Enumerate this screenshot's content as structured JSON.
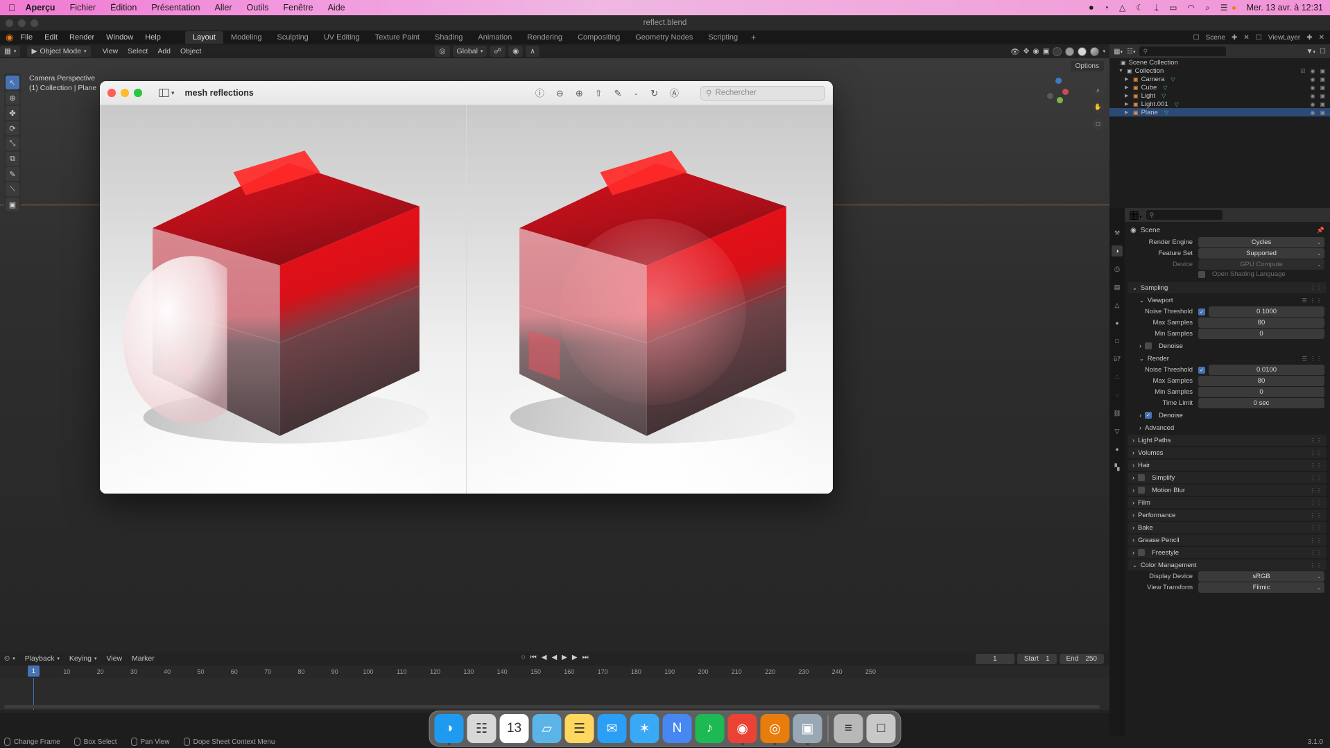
{
  "macbar": {
    "apple_icon": "apple-logo",
    "menus": [
      {
        "label": "Aperçu",
        "bold": true
      },
      {
        "label": "Fichier",
        "bold": false
      },
      {
        "label": "Édition",
        "bold": false
      },
      {
        "label": "Présentation",
        "bold": false
      },
      {
        "label": "Aller",
        "bold": false
      },
      {
        "label": "Outils",
        "bold": false
      },
      {
        "label": "Fenêtre",
        "bold": false
      },
      {
        "label": "Aide",
        "bold": false
      }
    ],
    "status_icons": [
      {
        "name": "record-icon",
        "glyph": "⏺"
      },
      {
        "name": "safari-compass-icon",
        "glyph": "◔"
      },
      {
        "name": "dropbox-icon",
        "glyph": "△"
      },
      {
        "name": "do-not-disturb-moon-icon",
        "glyph": "☾"
      },
      {
        "name": "bluetooth-icon",
        "glyph": "ᛦ"
      },
      {
        "name": "battery-charging-icon",
        "glyph": "▭"
      },
      {
        "name": "wifi-icon",
        "glyph": "◠"
      },
      {
        "name": "spotlight-search-icon",
        "glyph": "⌕"
      },
      {
        "name": "control-center-icon",
        "glyph": "☰"
      }
    ],
    "clock": "Mer. 13 avr. à  12:31",
    "accent_pink": "#f093d8"
  },
  "blender_window": {
    "filename": "reflect.blend"
  },
  "topbar": {
    "logo_icon": "blender-logo-icon",
    "menus": [
      "File",
      "Edit",
      "Render",
      "Window",
      "Help"
    ],
    "workspaces": [
      "Layout",
      "Modeling",
      "Sculpting",
      "UV Editing",
      "Texture Paint",
      "Shading",
      "Animation",
      "Rendering",
      "Compositing",
      "Geometry Nodes",
      "Scripting"
    ],
    "active_workspace": "Layout",
    "add_workspace": "+",
    "scene_label": "Scene",
    "viewlayer_label": "ViewLayer"
  },
  "viewport_header": {
    "mode": "Object Mode",
    "menus": [
      "View",
      "Select",
      "Add",
      "Object"
    ],
    "transform_orientation": "Global",
    "options_label": "Options",
    "icons": [
      "editor-type-icon",
      "mode-dropdown-icon",
      "snap-magnet-icon",
      "proportional-edit-icon",
      "overlays-icon",
      "xray-icon"
    ]
  },
  "viewport": {
    "overlay_line1": "Camera Perspective",
    "overlay_line2": "(1) Collection | Plane",
    "tools": [
      {
        "name": "tweak-select-tool",
        "glyph": "↖",
        "selected": true
      },
      {
        "name": "cursor-tool",
        "glyph": "⊕",
        "selected": false
      },
      {
        "name": "move-tool",
        "glyph": "✤",
        "selected": false
      },
      {
        "name": "rotate-tool",
        "glyph": "⟳",
        "selected": false
      },
      {
        "name": "scale-tool",
        "glyph": "⤡",
        "selected": false
      },
      {
        "name": "transform-tool",
        "glyph": "⧉",
        "selected": false
      },
      {
        "name": "annotate-tool",
        "glyph": "✎",
        "selected": false
      },
      {
        "name": "measure-tool",
        "glyph": "⟍",
        "selected": false
      },
      {
        "name": "add-cube-tool",
        "glyph": "▣",
        "selected": false
      }
    ],
    "nav_buttons": [
      {
        "name": "zoom-nav-button",
        "glyph": "⌕"
      },
      {
        "name": "pan-nav-button",
        "glyph": "✋"
      },
      {
        "name": "camera-view-button",
        "glyph": "□"
      }
    ],
    "gizmo_axes": [
      "X",
      "Y",
      "Z"
    ],
    "cursor_glyph": "+"
  },
  "preview_window": {
    "title": "mesh reflections",
    "traffic_lights": [
      "close-button",
      "minimize-button",
      "maximize-button"
    ],
    "sidebar_toggle_icon": "sidebar-toggle-icon",
    "toolbar_icons": [
      {
        "name": "info-icon",
        "glyph": "ⓘ"
      },
      {
        "name": "zoom-out-icon",
        "glyph": "⊖"
      },
      {
        "name": "zoom-in-icon",
        "glyph": "⊕"
      },
      {
        "name": "share-icon",
        "glyph": "⇧"
      },
      {
        "name": "markup-pen-icon",
        "glyph": "✎"
      },
      {
        "name": "markup-chevron-icon",
        "glyph": "⌄"
      },
      {
        "name": "rotate-icon",
        "glyph": "↻"
      },
      {
        "name": "annotate-icon",
        "glyph": "Ⓐ"
      }
    ],
    "search_placeholder": "Rechercher",
    "search_value": "",
    "image_description": "Two side-by-side renders of a translucent red glass cube on a glossy white floor with reflections"
  },
  "outliner": {
    "header_icons": [
      "editor-type-icon",
      "display-mode-icon",
      "filter-icon",
      "new-collection-icon"
    ],
    "search_placeholder": "",
    "rows": [
      {
        "label": "Scene Collection",
        "indent": 0,
        "icon": "scene-collection-icon",
        "expand": "",
        "selected": false,
        "eyes": false
      },
      {
        "label": "Collection",
        "indent": 1,
        "icon": "collection-icon",
        "expand": "▼",
        "selected": false,
        "eyes": true,
        "check": true
      },
      {
        "label": "Camera",
        "indent": 2,
        "icon": "camera-object-icon",
        "expand": "▶",
        "selected": false,
        "eyes": true,
        "data_icon": "camera-data-icon"
      },
      {
        "label": "Cube",
        "indent": 2,
        "icon": "mesh-object-icon",
        "expand": "▶",
        "selected": false,
        "eyes": true,
        "data_icon": "mesh-data-icon"
      },
      {
        "label": "Light",
        "indent": 2,
        "icon": "light-object-icon",
        "expand": "▶",
        "selected": false,
        "eyes": true,
        "data_icon": "light-data-icon"
      },
      {
        "label": "Light.001",
        "indent": 2,
        "icon": "light-object-icon",
        "expand": "▶",
        "selected": false,
        "eyes": true,
        "data_icon": "light-data-icon"
      },
      {
        "label": "Plane",
        "indent": 2,
        "icon": "mesh-object-icon",
        "expand": "▶",
        "selected": true,
        "eyes": true,
        "data_icon": "mesh-data-icon"
      }
    ]
  },
  "properties": {
    "tabs": [
      {
        "name": "tool-tab",
        "glyph": "⚒",
        "active": false
      },
      {
        "name": "render-tab",
        "glyph": "◑",
        "active": true
      },
      {
        "name": "output-tab",
        "glyph": "⎙",
        "active": false
      },
      {
        "name": "view-layer-tab",
        "glyph": "▤",
        "active": false
      },
      {
        "name": "scene-tab",
        "glyph": "△",
        "active": false
      },
      {
        "name": "world-tab",
        "glyph": "●",
        "active": false
      },
      {
        "name": "object-tab",
        "glyph": "□",
        "active": false
      },
      {
        "name": "modifier-tab",
        "glyph": "ὒ7",
        "active": false
      },
      {
        "name": "particles-tab",
        "glyph": "∴",
        "active": false
      },
      {
        "name": "physics-tab",
        "glyph": "◌",
        "active": false
      },
      {
        "name": "constraints-tab",
        "glyph": "⛓",
        "active": false
      },
      {
        "name": "data-tab",
        "glyph": "▽",
        "active": false
      },
      {
        "name": "material-tab",
        "glyph": "●",
        "active": false
      },
      {
        "name": "texture-tab",
        "glyph": "▚",
        "active": false
      }
    ],
    "breadcrumb": "Scene",
    "search_placeholder": "",
    "fields": [
      {
        "label": "Render Engine",
        "value": "Cycles",
        "dropdown": true,
        "dim": false
      },
      {
        "label": "Feature Set",
        "value": "Supported",
        "dropdown": true,
        "dim": false
      },
      {
        "label": "Device",
        "value": "GPU Compute",
        "dropdown": true,
        "dim": true
      }
    ],
    "osl_label": "Open Shading Language",
    "osl_checked": false,
    "sampling": {
      "title": "Sampling",
      "viewport": {
        "title": "Viewport",
        "rows": [
          {
            "label": "Noise Threshold",
            "value": "0.1000",
            "checkbox": true,
            "checked": true
          },
          {
            "label": "Max Samples",
            "value": "80",
            "checkbox": false
          },
          {
            "label": "Min Samples",
            "value": "0",
            "checkbox": false
          }
        ],
        "denoise_label": "Denoise",
        "denoise_checked": false
      },
      "render": {
        "title": "Render",
        "rows": [
          {
            "label": "Noise Threshold",
            "value": "0.0100",
            "checkbox": true,
            "checked": true
          },
          {
            "label": "Max Samples",
            "value": "80",
            "checkbox": false
          },
          {
            "label": "Min Samples",
            "value": "0",
            "checkbox": false
          },
          {
            "label": "Time Limit",
            "value": "0 sec",
            "checkbox": false
          }
        ],
        "denoise_label": "Denoise",
        "denoise_checked": true,
        "advanced_label": "Advanced"
      }
    },
    "collapsed_panels": [
      {
        "label": "Light Paths",
        "checkbox": false
      },
      {
        "label": "Volumes",
        "checkbox": false
      },
      {
        "label": "Hair",
        "checkbox": false
      },
      {
        "label": "Simplify",
        "checkbox": true
      },
      {
        "label": "Motion Blur",
        "checkbox": true
      },
      {
        "label": "Film",
        "checkbox": false
      },
      {
        "label": "Performance",
        "checkbox": false
      },
      {
        "label": "Bake",
        "checkbox": false
      },
      {
        "label": "Grease Pencil",
        "checkbox": false
      },
      {
        "label": "Freestyle",
        "checkbox": true
      }
    ],
    "color_management": {
      "title": "Color Management",
      "rows": [
        {
          "label": "Display Device",
          "value": "sRGB"
        },
        {
          "label": "View Transform",
          "value": "Filmic"
        }
      ]
    }
  },
  "timeline": {
    "header_items": [
      "Playback",
      "Keying",
      "View",
      "Marker"
    ],
    "editor_icon": "timeline-editor-icon",
    "transport": [
      {
        "name": "jump-start-button",
        "glyph": "⏮"
      },
      {
        "name": "prev-keyframe-button",
        "glyph": "◀"
      },
      {
        "name": "play-reverse-button",
        "glyph": "◀"
      },
      {
        "name": "play-button",
        "glyph": "▶"
      },
      {
        "name": "next-keyframe-button",
        "glyph": "▶"
      },
      {
        "name": "jump-end-button",
        "glyph": "⏭"
      }
    ],
    "current_frame": "1",
    "start_label": "Start",
    "start_value": "1",
    "end_label": "End",
    "end_value": "250",
    "ruler_ticks": [
      "10",
      "20",
      "30",
      "40",
      "50",
      "60",
      "70",
      "80",
      "90",
      "100",
      "110",
      "120",
      "130",
      "140",
      "150",
      "160",
      "170",
      "180",
      "190",
      "200",
      "210",
      "220",
      "230",
      "240",
      "250"
    ],
    "playhead_frame": "1"
  },
  "statusbar": {
    "items": [
      {
        "icon": "left-mouse-icon",
        "label": "Change Frame"
      },
      {
        "icon": "left-mouse-icon",
        "label": "Box Select"
      },
      {
        "icon": "middle-mouse-icon",
        "label": "Pan View"
      },
      {
        "icon": "right-mouse-icon",
        "label": "Dope Sheet Context Menu"
      }
    ],
    "version": "3.1.0"
  },
  "dock": {
    "items": [
      {
        "name": "finder-icon",
        "glyph": "◑",
        "color": "#1e9bf0",
        "running": true
      },
      {
        "name": "launchpad-icon",
        "glyph": "☷",
        "color": "#d8d8d8",
        "running": false
      },
      {
        "name": "calendar-icon",
        "glyph": "13",
        "color": "#ffffff",
        "running": false
      },
      {
        "name": "folder-icon",
        "glyph": "▱",
        "color": "#5ab4e8",
        "running": false
      },
      {
        "name": "notes-icon",
        "glyph": "☰",
        "color": "#ffd75e",
        "running": false
      },
      {
        "name": "mail-icon",
        "glyph": "✉",
        "color": "#2b9ef5",
        "running": false
      },
      {
        "name": "safari-icon",
        "glyph": "✶",
        "color": "#3aa9f5",
        "running": false
      },
      {
        "name": "nordvpn-icon",
        "glyph": "N",
        "color": "#4687f2",
        "running": false
      },
      {
        "name": "spotify-icon",
        "glyph": "♪",
        "color": "#1db954",
        "running": false
      },
      {
        "name": "chrome-icon",
        "glyph": "◉",
        "color": "#ea4335",
        "running": true
      },
      {
        "name": "blender-icon",
        "glyph": "◎",
        "color": "#e87d0d",
        "running": true
      },
      {
        "name": "preview-icon",
        "glyph": "▣",
        "color": "#9aa8b5",
        "running": true
      },
      {
        "name": "downloads-stack-icon",
        "glyph": "≡",
        "color": "#b8b8b8",
        "running": false
      },
      {
        "name": "trash-icon",
        "glyph": "□",
        "color": "#c8c8c8",
        "running": false
      }
    ]
  }
}
